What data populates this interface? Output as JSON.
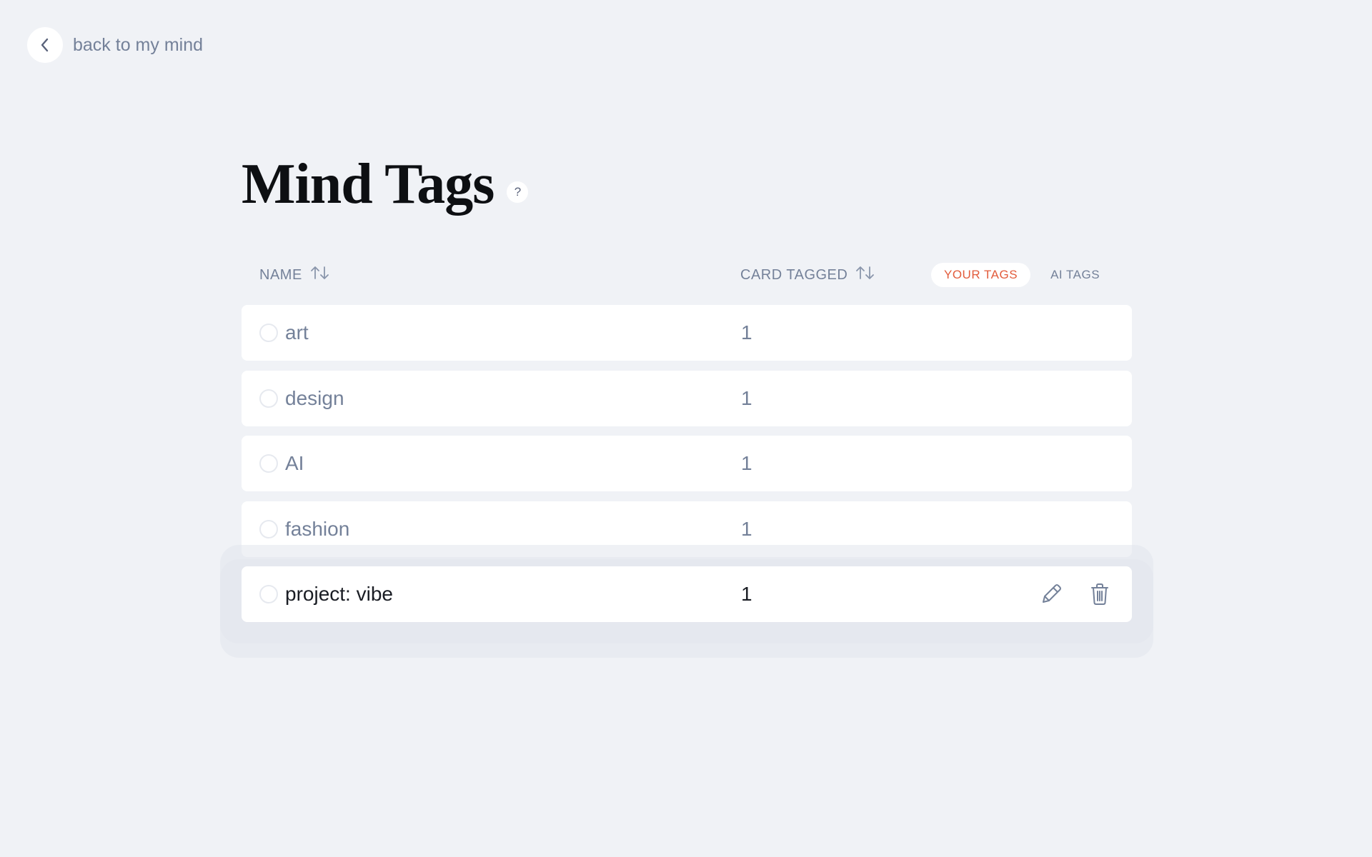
{
  "nav": {
    "back_label": "back to my mind"
  },
  "page": {
    "title": "Mind Tags",
    "help_label": "?"
  },
  "table": {
    "col_name": "NAME",
    "col_count": "CARD TAGGED",
    "tab_your": "YOUR TAGS",
    "tab_ai": "AI TAGS",
    "rows": [
      {
        "name": "art",
        "count": "1"
      },
      {
        "name": "design",
        "count": "1"
      },
      {
        "name": "AI",
        "count": "1"
      },
      {
        "name": "fashion",
        "count": "1"
      },
      {
        "name": "project: vibe",
        "count": "1"
      }
    ]
  },
  "colors": {
    "accent": "#e25c3c",
    "background": "#f0f2f6",
    "muted_text": "#748199"
  },
  "icons": [
    "chevron-left-icon",
    "sort-icon",
    "pencil-icon",
    "trash-icon"
  ]
}
